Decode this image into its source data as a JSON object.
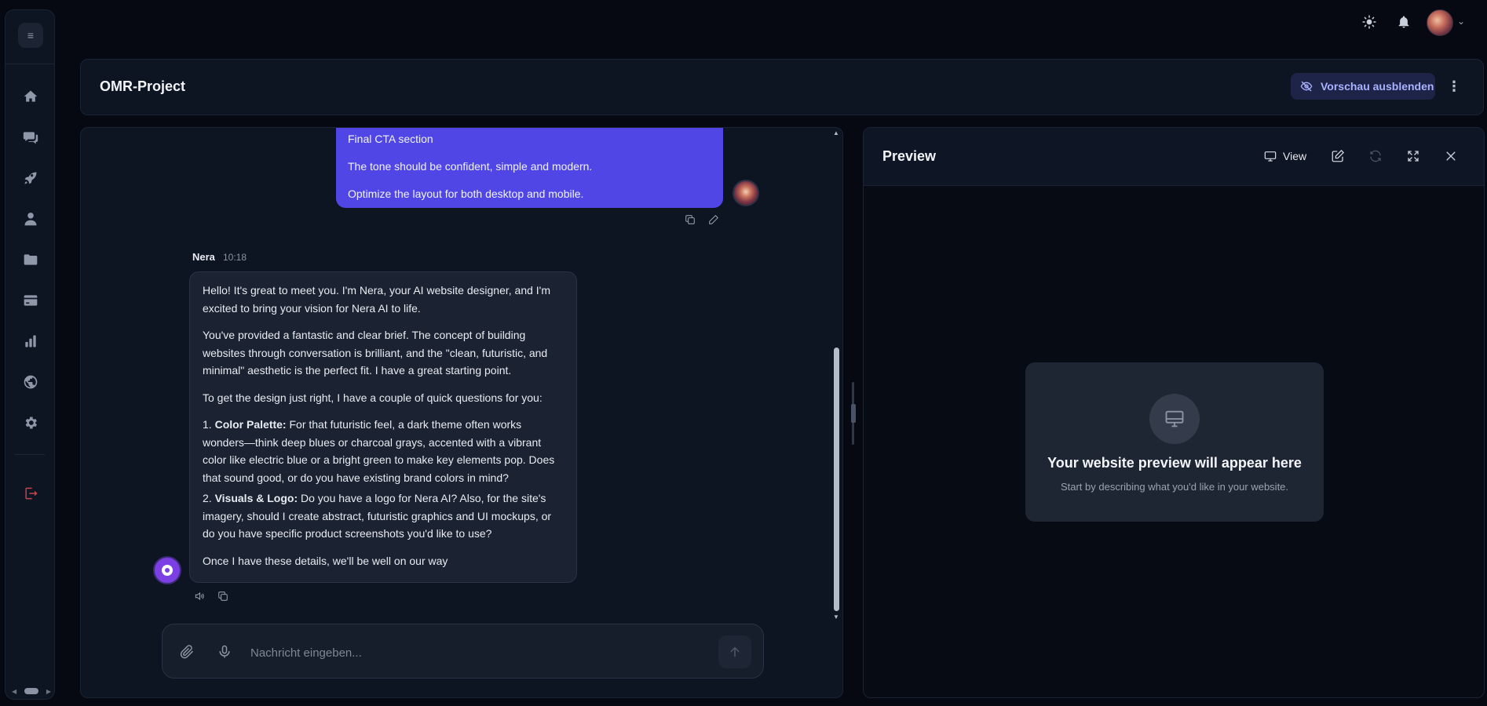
{
  "colors": {
    "background": "#060912",
    "panel": "#0d1422",
    "accent": "#4f46e5",
    "danger": "#c2454f"
  },
  "sidebar": {
    "menu_icon": "menu-icon",
    "items": [
      {
        "name": "home",
        "icon": "home-icon"
      },
      {
        "name": "chats",
        "icon": "chat-icon"
      },
      {
        "name": "deploy",
        "icon": "rocket-icon"
      },
      {
        "name": "profile",
        "icon": "user-icon"
      },
      {
        "name": "projects",
        "icon": "folder-icon"
      },
      {
        "name": "billing",
        "icon": "credit-card-icon"
      },
      {
        "name": "analytics",
        "icon": "bar-chart-icon"
      },
      {
        "name": "domains",
        "icon": "globe-icon"
      },
      {
        "name": "settings",
        "icon": "gear-icon"
      }
    ],
    "logout_icon": "logout-icon"
  },
  "topbar": {
    "theme_icon": "sun-icon",
    "notifications_icon": "bell-icon",
    "user_menu_icon": "chevron-down-icon"
  },
  "project": {
    "title": "OMR-Project",
    "hide_preview_label": "Vorschau ausblenden",
    "more_icon": "more-vertical-icon"
  },
  "chat": {
    "user_message": [
      "Final CTA section",
      "The tone should be confident, simple and modern.",
      "Optimize the layout for both desktop and mobile."
    ],
    "assistant": {
      "name": "Nera",
      "time": "10:18",
      "p1": "Hello! It's great to meet you. I'm Nera, your AI website designer, and I'm excited to bring your vision for Nera AI to life.",
      "p2": "You've provided a fantastic and clear brief. The concept of building websites through conversation is brilliant, and the \"clean, futuristic, and minimal\" aesthetic is the perfect fit. I have a great starting point.",
      "p3": "To get the design just right, I have a couple of quick questions for you:",
      "q1_number": "1.",
      "q1_title": "Color Palette:",
      "q1_text": "For that futuristic feel, a dark theme often works wonders—think deep blues or charcoal grays, accented with a vibrant color like electric blue or a bright green to make key elements pop. Does that sound good, or do you have existing brand colors in mind?",
      "q2_number": "2.",
      "q2_title": "Visuals & Logo:",
      "q2_text": "Do you have a logo for Nera AI? Also, for the site's imagery, should I create abstract, futuristic graphics and UI mockups, or do you have specific product screenshots you'd like to use?",
      "p4": "Once I have these details, we'll be well on our way"
    },
    "input": {
      "value": "",
      "placeholder": "Nachricht eingeben..."
    }
  },
  "preview": {
    "title": "Preview",
    "view_label": "View",
    "empty_title": "Your website preview will appear here",
    "empty_subtitle": "Start by describing what you'd like in your website."
  }
}
